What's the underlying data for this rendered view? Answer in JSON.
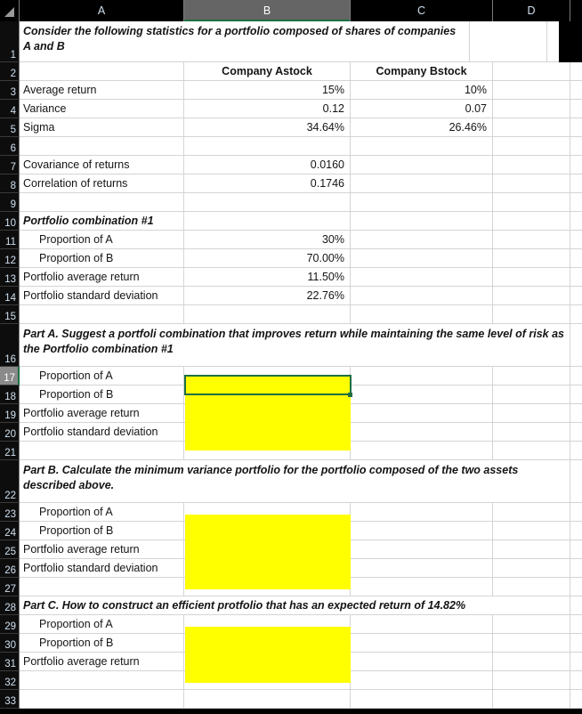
{
  "columns": [
    {
      "label": "A",
      "selected": false
    },
    {
      "label": "B",
      "selected": true
    },
    {
      "label": "C",
      "selected": false
    },
    {
      "label": "D",
      "selected": false
    },
    {
      "label": "",
      "selected": false
    }
  ],
  "selection": {
    "active_cell": "B17",
    "selected_column": "B",
    "selected_row": "17",
    "border_color": "#1f6f43",
    "highlight_fill": "#ffff00"
  },
  "rows": {
    "r1": {
      "num": "1",
      "a": "Consider the following statistics for a portfolio composed of shares of companies A and B"
    },
    "r2": {
      "num": "2",
      "a": "",
      "b": "Company Astock",
      "c": "Company Bstock",
      "d": ""
    },
    "r3": {
      "num": "3",
      "a": "Average return",
      "b": "15%",
      "c": "10%",
      "d": ""
    },
    "r4": {
      "num": "4",
      "a": "Variance",
      "b": "0.12",
      "c": "0.07",
      "d": ""
    },
    "r5": {
      "num": "5",
      "a": "Sigma",
      "b": "34.64%",
      "c": "26.46%",
      "d": ""
    },
    "r6": {
      "num": "6",
      "a": "",
      "b": "",
      "c": "",
      "d": ""
    },
    "r7": {
      "num": "7",
      "a": "Covariance of returns",
      "b": "0.0160",
      "c": "",
      "d": ""
    },
    "r8": {
      "num": "8",
      "a": "Correlation of returns",
      "b": "0.1746",
      "c": "",
      "d": ""
    },
    "r9": {
      "num": "9",
      "a": "",
      "b": "",
      "c": "",
      "d": ""
    },
    "r10": {
      "num": "10",
      "a": "Portfolio combination #1",
      "b": "",
      "c": "",
      "d": ""
    },
    "r11": {
      "num": "11",
      "a": "Proportion of A",
      "b": "30%",
      "c": "",
      "d": ""
    },
    "r12": {
      "num": "12",
      "a": "Proportion of B",
      "b": "70.00%",
      "c": "",
      "d": ""
    },
    "r13": {
      "num": "13",
      "a": "Portfolio average return",
      "b": "11.50%",
      "c": "",
      "d": ""
    },
    "r14": {
      "num": "14",
      "a": "Portfolio standard deviation",
      "b": "22.76%",
      "c": "",
      "d": ""
    },
    "r15": {
      "num": "15",
      "a": "",
      "b": "",
      "c": "",
      "d": ""
    },
    "r16": {
      "num": "16",
      "a": "Part A. Suggest a portfoli combination that improves return while maintaining the same level of risk as the Portfolio combination #1"
    },
    "r17": {
      "num": "17",
      "a": "Proportion of A",
      "b": "",
      "c": "",
      "d": ""
    },
    "r18": {
      "num": "18",
      "a": "Proportion of B",
      "b": "",
      "c": "",
      "d": ""
    },
    "r19": {
      "num": "19",
      "a": "Portfolio average return",
      "b": "",
      "c": "",
      "d": ""
    },
    "r20": {
      "num": "20",
      "a": "Portfolio standard deviation",
      "b": "",
      "c": "",
      "d": ""
    },
    "r21": {
      "num": "21",
      "a": "",
      "b": "",
      "c": "",
      "d": ""
    },
    "r22": {
      "num": "22",
      "a": "Part B. Calculate the minimum variance portfolio for the portfolio composed of the two assets described above."
    },
    "r23": {
      "num": "23",
      "a": "Proportion of A",
      "b": "",
      "c": "",
      "d": ""
    },
    "r24": {
      "num": "24",
      "a": "Proportion of B",
      "b": "",
      "c": "",
      "d": ""
    },
    "r25": {
      "num": "25",
      "a": "Portfolio average return",
      "b": "",
      "c": "",
      "d": ""
    },
    "r26": {
      "num": "26",
      "a": "Portfolio standard deviation",
      "b": "",
      "c": "",
      "d": ""
    },
    "r27": {
      "num": "27",
      "a": "",
      "b": "",
      "c": "",
      "d": ""
    },
    "r28": {
      "num": "28",
      "a": "Part C. How to construct an efficient protfolio that has an expected return of 14.82%"
    },
    "r29": {
      "num": "29",
      "a": "Proportion of A",
      "b": "",
      "c": "",
      "d": ""
    },
    "r30": {
      "num": "30",
      "a": "Proportion of B",
      "b": "",
      "c": "",
      "d": ""
    },
    "r31": {
      "num": "31",
      "a": "Portfolio average return",
      "b": "",
      "c": "",
      "d": ""
    },
    "r32": {
      "num": "32",
      "a": "",
      "b": "",
      "c": "",
      "d": ""
    },
    "r33": {
      "num": "33",
      "a": "",
      "b": "",
      "c": "",
      "d": ""
    }
  }
}
